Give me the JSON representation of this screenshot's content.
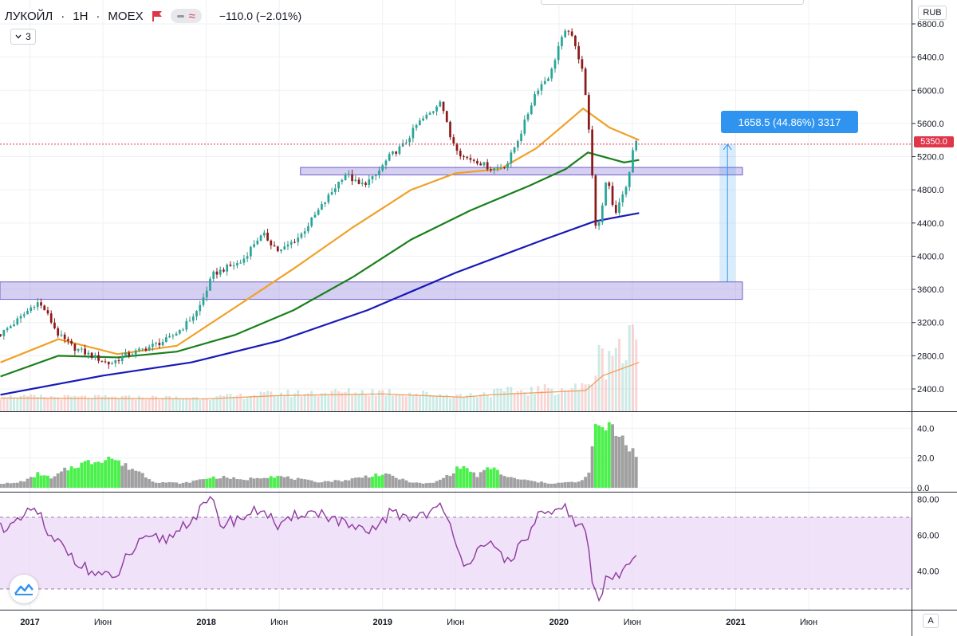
{
  "header": {
    "symbol": "ЛУКОЙЛ",
    "interval": "1Н",
    "exchange": "MOEX",
    "separator": "·",
    "change_text": "−110.0 (−2.01%)",
    "collapse_count": "3",
    "currency": "RUB"
  },
  "toolbar": {
    "autoscale_label": "A"
  },
  "colors": {
    "up": "#26a69a",
    "down": "#8b1a1a",
    "ma_fast": "#f0a128",
    "ma_mid": "#1a7f1a",
    "ma_slow": "#1818b8",
    "zone": "#9b8ce0",
    "rsi": "#8e3a9e",
    "vol_ma": "#f0a060",
    "indicator_green": "#4cf04c",
    "indicator_gray": "#a0a0a0",
    "measure": "#2f94f0",
    "last_price": "#e0364a"
  },
  "chart_data": [
    {
      "type": "candlestick",
      "title": "ЛУКОЙЛ · 1Н · MOEX",
      "x_range": [
        "2016-10-31",
        "2021-12-31"
      ],
      "ylim": [
        2200,
        6900
      ],
      "y_ticks": [
        2400,
        2800,
        3200,
        3600,
        4000,
        4400,
        4800,
        5200,
        5600,
        6000,
        6400,
        6800
      ],
      "x_tick_labels": [
        {
          "date": "2017-01-01",
          "label": "2017"
        },
        {
          "date": "2017-06-01",
          "label": "Июн"
        },
        {
          "date": "2018-01-01",
          "label": "2018"
        },
        {
          "date": "2018-06-01",
          "label": "Июн"
        },
        {
          "date": "2019-01-01",
          "label": "2019"
        },
        {
          "date": "2019-06-01",
          "label": "Июн"
        },
        {
          "date": "2020-01-01",
          "label": "2020"
        },
        {
          "date": "2020-06-01",
          "label": "Июн"
        },
        {
          "date": "2021-01-01",
          "label": "2021"
        },
        {
          "date": "2021-06-01",
          "label": "Июн"
        }
      ],
      "close_path": [
        [
          "2016-11-01",
          3060
        ],
        [
          "2016-12-15",
          3270
        ],
        [
          "2017-01-15",
          3450
        ],
        [
          "2017-02-01",
          3350
        ],
        [
          "2017-03-01",
          3050
        ],
        [
          "2017-04-01",
          2900
        ],
        [
          "2017-05-01",
          2820
        ],
        [
          "2017-06-15",
          2700
        ],
        [
          "2017-07-15",
          2800
        ],
        [
          "2017-08-15",
          2860
        ],
        [
          "2017-09-15",
          2930
        ],
        [
          "2017-10-15",
          3000
        ],
        [
          "2017-11-15",
          3150
        ],
        [
          "2017-12-15",
          3350
        ],
        [
          "2018-01-15",
          3780
        ],
        [
          "2018-02-15",
          3870
        ],
        [
          "2018-03-15",
          3930
        ],
        [
          "2018-04-15",
          4200
        ],
        [
          "2018-05-01",
          4250
        ],
        [
          "2018-06-01",
          4050
        ],
        [
          "2018-07-15",
          4250
        ],
        [
          "2018-08-15",
          4500
        ],
        [
          "2018-09-15",
          4750
        ],
        [
          "2018-10-15",
          5000
        ],
        [
          "2018-11-15",
          4850
        ],
        [
          "2018-12-15",
          4950
        ],
        [
          "2019-01-15",
          5200
        ],
        [
          "2019-02-15",
          5350
        ],
        [
          "2019-03-15",
          5600
        ],
        [
          "2019-04-15",
          5750
        ],
        [
          "2019-05-01",
          5900
        ],
        [
          "2019-05-20",
          5450
        ],
        [
          "2019-06-15",
          5200
        ],
        [
          "2019-07-15",
          5150
        ],
        [
          "2019-08-15",
          5050
        ],
        [
          "2019-09-15",
          5100
        ],
        [
          "2019-10-15",
          5500
        ],
        [
          "2019-11-15",
          6000
        ],
        [
          "2019-12-15",
          6200
        ],
        [
          "2020-01-01",
          6550
        ],
        [
          "2020-01-20",
          6750
        ],
        [
          "2020-02-05",
          6500
        ],
        [
          "2020-02-20",
          6250
        ],
        [
          "2020-03-01",
          5650
        ],
        [
          "2020-03-10",
          5000
        ],
        [
          "2020-03-18",
          4250
        ],
        [
          "2020-03-25",
          4400
        ],
        [
          "2020-04-10",
          5000
        ],
        [
          "2020-04-25",
          4500
        ],
        [
          "2020-05-10",
          4700
        ],
        [
          "2020-05-25",
          4950
        ],
        [
          "2020-06-05",
          5400
        ],
        [
          "2020-06-15",
          5350
        ]
      ],
      "ma_fast": [
        [
          "2016-11-01",
          2720
        ],
        [
          "2017-03-01",
          3000
        ],
        [
          "2017-07-01",
          2820
        ],
        [
          "2017-11-01",
          2920
        ],
        [
          "2018-03-01",
          3380
        ],
        [
          "2018-07-01",
          3850
        ],
        [
          "2018-11-01",
          4350
        ],
        [
          "2019-03-01",
          4800
        ],
        [
          "2019-06-01",
          5000
        ],
        [
          "2019-09-01",
          5050
        ],
        [
          "2019-11-15",
          5300
        ],
        [
          "2020-01-15",
          5600
        ],
        [
          "2020-02-20",
          5780
        ],
        [
          "2020-04-15",
          5550
        ],
        [
          "2020-06-15",
          5400
        ]
      ],
      "ma_mid": [
        [
          "2016-11-01",
          2550
        ],
        [
          "2017-03-01",
          2800
        ],
        [
          "2017-07-01",
          2780
        ],
        [
          "2017-11-01",
          2850
        ],
        [
          "2018-03-01",
          3050
        ],
        [
          "2018-07-01",
          3350
        ],
        [
          "2018-11-01",
          3750
        ],
        [
          "2019-03-01",
          4200
        ],
        [
          "2019-07-01",
          4550
        ],
        [
          "2019-11-01",
          4850
        ],
        [
          "2020-01-15",
          5050
        ],
        [
          "2020-03-01",
          5250
        ],
        [
          "2020-05-15",
          5130
        ],
        [
          "2020-06-15",
          5160
        ]
      ],
      "ma_slow": [
        [
          "2016-11-01",
          2330
        ],
        [
          "2017-06-01",
          2560
        ],
        [
          "2017-12-01",
          2720
        ],
        [
          "2018-06-01",
          2980
        ],
        [
          "2018-12-01",
          3350
        ],
        [
          "2019-06-01",
          3800
        ],
        [
          "2019-12-01",
          4200
        ],
        [
          "2020-03-15",
          4420
        ],
        [
          "2020-06-15",
          4520
        ]
      ],
      "horizontal_zones": [
        {
          "x": [
            "2018-07-15",
            "2021-01-15"
          ],
          "y": [
            4980,
            5070
          ]
        },
        {
          "x": [
            "2016-10-31",
            "2021-01-15"
          ],
          "y": [
            3480,
            3690
          ]
        }
      ],
      "last_price": 5350.0,
      "last_price_label": "5350.0",
      "measure": {
        "from": 3691.5,
        "to": 5350.0,
        "date": "2020-12-15",
        "label": "1658.5 (44.86%) 3317"
      }
    },
    {
      "type": "bar",
      "name": "volume",
      "volume_ma": [
        [
          "2016-11-01",
          2290
        ],
        [
          "2018-01-01",
          2280
        ],
        [
          "2018-06-01",
          2320
        ],
        [
          "2019-01-01",
          2340
        ],
        [
          "2019-06-15",
          2300
        ],
        [
          "2019-08-15",
          2330
        ],
        [
          "2020-01-15",
          2370
        ],
        [
          "2020-02-25",
          2380
        ],
        [
          "2020-04-01",
          2560
        ],
        [
          "2020-06-15",
          2720
        ]
      ]
    },
    {
      "type": "bar",
      "name": "indicator",
      "ylim": [
        0,
        45
      ],
      "y_ticks": [
        0,
        20,
        40
      ],
      "y_tick_labels": [
        "0.0",
        "20.0",
        "40.0"
      ],
      "green_intervals": [
        [
          "2017-01-05",
          "2017-02-10"
        ],
        [
          "2017-03-20",
          "2017-07-05"
        ],
        [
          "2018-01-01",
          "2018-01-20"
        ],
        [
          "2018-05-15",
          "2018-06-01"
        ],
        [
          "2018-12-05",
          "2019-01-05"
        ],
        [
          "2019-06-01",
          "2019-07-05"
        ],
        [
          "2019-08-01",
          "2019-09-01"
        ],
        [
          "2020-03-15",
          "2020-04-20"
        ]
      ],
      "points": [
        [
          "2016-11-01",
          3
        ],
        [
          "2016-12-01",
          3
        ],
        [
          "2017-01-01",
          6
        ],
        [
          "2017-01-20",
          10
        ],
        [
          "2017-02-15",
          6
        ],
        [
          "2017-03-15",
          12
        ],
        [
          "2017-04-15",
          16
        ],
        [
          "2017-05-15",
          18
        ],
        [
          "2017-06-15",
          21
        ],
        [
          "2017-07-15",
          15
        ],
        [
          "2017-08-15",
          11
        ],
        [
          "2017-09-15",
          4
        ],
        [
          "2017-11-15",
          3
        ],
        [
          "2018-01-10",
          7
        ],
        [
          "2018-02-15",
          7
        ],
        [
          "2018-03-15",
          5
        ],
        [
          "2018-04-15",
          7
        ],
        [
          "2018-05-20",
          8
        ],
        [
          "2018-06-15",
          7
        ],
        [
          "2018-08-15",
          4
        ],
        [
          "2018-10-15",
          5
        ],
        [
          "2018-12-20",
          9
        ],
        [
          "2019-01-20",
          8
        ],
        [
          "2019-02-15",
          5
        ],
        [
          "2019-03-15",
          3
        ],
        [
          "2019-04-15",
          3
        ],
        [
          "2019-05-15",
          8
        ],
        [
          "2019-06-15",
          15
        ],
        [
          "2019-07-15",
          8
        ],
        [
          "2019-08-15",
          14
        ],
        [
          "2019-09-15",
          7
        ],
        [
          "2019-11-15",
          4
        ],
        [
          "2019-12-15",
          3
        ],
        [
          "2020-02-15",
          4
        ],
        [
          "2020-03-01",
          8
        ],
        [
          "2020-03-10",
          25
        ],
        [
          "2020-03-20",
          45
        ],
        [
          "2020-04-01",
          38
        ],
        [
          "2020-04-20",
          40
        ],
        [
          "2020-05-10",
          35
        ],
        [
          "2020-05-25",
          28
        ],
        [
          "2020-06-15",
          22
        ]
      ]
    },
    {
      "type": "line",
      "name": "rsi",
      "ylim": [
        20,
        82
      ],
      "y_ticks": [
        40,
        60,
        80
      ],
      "y_tick_labels": [
        "40.00",
        "60.00",
        "80.00"
      ],
      "band": [
        30,
        70
      ],
      "points": [
        [
          "2016-11-01",
          65
        ],
        [
          "2016-12-01",
          65
        ],
        [
          "2016-12-20",
          70
        ],
        [
          "2017-01-10",
          75
        ],
        [
          "2017-01-25",
          70
        ],
        [
          "2017-02-05",
          58
        ],
        [
          "2017-03-01",
          56
        ],
        [
          "2017-04-01",
          48
        ],
        [
          "2017-05-01",
          40
        ],
        [
          "2017-06-01",
          38
        ],
        [
          "2017-06-25",
          34
        ],
        [
          "2017-07-15",
          46
        ],
        [
          "2017-08-15",
          55
        ],
        [
          "2017-09-15",
          58
        ],
        [
          "2017-10-15",
          58
        ],
        [
          "2017-11-15",
          66
        ],
        [
          "2017-12-15",
          72
        ],
        [
          "2018-01-10",
          80
        ],
        [
          "2018-02-01",
          66
        ],
        [
          "2018-03-15",
          70
        ],
        [
          "2018-05-01",
          75
        ],
        [
          "2018-06-01",
          63
        ],
        [
          "2018-07-15",
          73
        ],
        [
          "2018-09-01",
          72
        ],
        [
          "2018-10-15",
          66
        ],
        [
          "2018-12-01",
          60
        ],
        [
          "2019-01-15",
          72
        ],
        [
          "2019-03-01",
          70
        ],
        [
          "2019-05-01",
          75
        ],
        [
          "2019-06-01",
          60
        ],
        [
          "2019-06-15",
          44
        ],
        [
          "2019-07-15",
          50
        ],
        [
          "2019-08-15",
          54
        ],
        [
          "2019-09-15",
          46
        ],
        [
          "2019-10-20",
          55
        ],
        [
          "2019-11-20",
          72
        ],
        [
          "2019-12-20",
          70
        ],
        [
          "2020-01-15",
          76
        ],
        [
          "2020-02-10",
          65
        ],
        [
          "2020-02-25",
          63
        ],
        [
          "2020-03-10",
          35
        ],
        [
          "2020-03-20",
          24
        ],
        [
          "2020-03-30",
          25
        ],
        [
          "2020-04-10",
          40
        ],
        [
          "2020-04-25",
          35
        ],
        [
          "2020-05-15",
          40
        ],
        [
          "2020-06-01",
          50
        ],
        [
          "2020-06-15",
          50
        ]
      ]
    }
  ]
}
